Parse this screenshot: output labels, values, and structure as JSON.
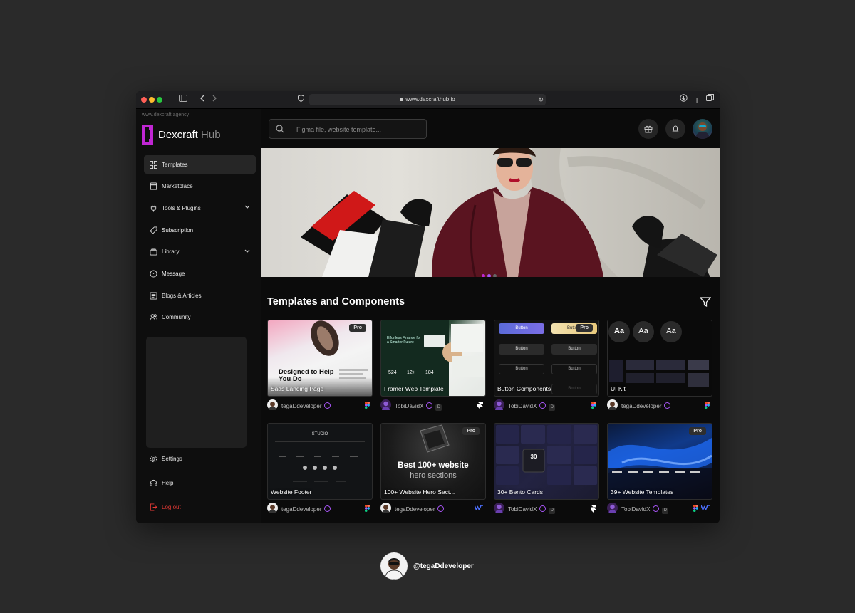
{
  "browser": {
    "url": "www.dexcrafthub.io"
  },
  "sidebar": {
    "agency": "www.dexcraft.agency",
    "brand": "Dexcraft",
    "brand_suffix": "Hub",
    "items": [
      {
        "label": "Templates",
        "icon": "grid-icon"
      },
      {
        "label": "Marketplace",
        "icon": "store-icon"
      },
      {
        "label": "Tools & Plugins",
        "icon": "plug-icon"
      },
      {
        "label": "Subscription",
        "icon": "tag-icon"
      },
      {
        "label": "Library",
        "icon": "library-icon"
      },
      {
        "label": "Message",
        "icon": "chat-icon"
      },
      {
        "label": "Blogs & Articles",
        "icon": "blog-icon"
      },
      {
        "label": "Community",
        "icon": "community-icon"
      }
    ],
    "bottom": [
      {
        "label": "Settings",
        "icon": "gear-icon"
      },
      {
        "label": "Help",
        "icon": "headset-icon"
      },
      {
        "label": "Log out",
        "icon": "logout-icon"
      }
    ]
  },
  "search": {
    "placeholder": "Figma file, website template..."
  },
  "section_title": "Templates and Components",
  "cards": [
    {
      "title": "Saas Landing Page",
      "author": "tegaDdeveloper",
      "pro": "Pro",
      "tools": [
        "figma"
      ]
    },
    {
      "title": "Framer Web Template",
      "author": "TobiDavidX",
      "pro": "",
      "tools": [
        "framer"
      ]
    },
    {
      "title": "Button Components",
      "author": "TobiDavidX",
      "pro": "Pro",
      "tools": [
        "figma"
      ]
    },
    {
      "title": "UI Kit",
      "author": "tegaDdeveloper",
      "pro": "",
      "tools": [
        "figma"
      ]
    },
    {
      "title": "Website Footer",
      "author": "tegaDdeveloper",
      "pro": "",
      "tools": [
        "figma"
      ]
    },
    {
      "title": "100+ Website Hero Sect...",
      "author": "tegaDdeveloper",
      "pro": "Pro",
      "tools": [
        "webflow"
      ]
    },
    {
      "title": "30+ Bento Cards",
      "author": "TobiDavidX",
      "pro": "",
      "tools": [
        "framer"
      ]
    },
    {
      "title": "39+ Website Templates",
      "author": "TobiDavidX",
      "pro": "Pro",
      "tools": [
        "figma",
        "webflow"
      ]
    }
  ],
  "thumb_text": {
    "saas_headline": "Designed to Help You Do",
    "framer_headline": "Effortless Finance for a Smarter Future",
    "btn_label": "Button",
    "font_sample": "Aa",
    "studio": "STUDIO",
    "hero_big": "Best 100+ website",
    "hero_sub": "hero sections",
    "bento_num": "30"
  },
  "footer": {
    "handle": "@tegaDdeveloper"
  },
  "colors": {
    "accent": "#c026d3",
    "verified": "#a855f7",
    "logout": "#e53935"
  }
}
